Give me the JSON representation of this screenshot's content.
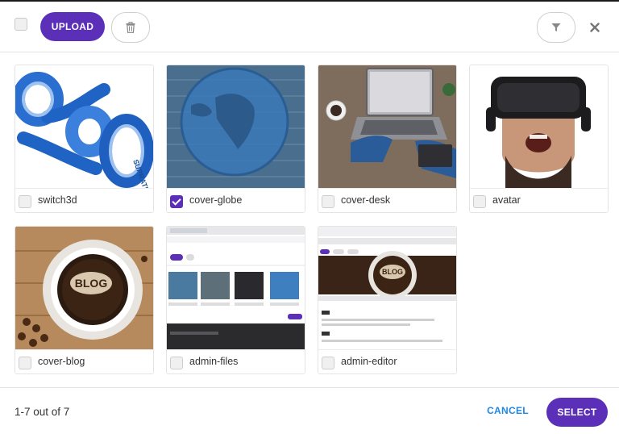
{
  "header": {
    "upload_label": "UPLOAD",
    "delete_icon": "trash-icon",
    "filter_icon": "filter-icon",
    "close_icon": "close-icon"
  },
  "files": [
    {
      "name": "switch3d",
      "checked": false
    },
    {
      "name": "cover-globe",
      "checked": true
    },
    {
      "name": "cover-desk",
      "checked": false
    },
    {
      "name": "avatar",
      "checked": false
    },
    {
      "name": "cover-blog",
      "checked": false
    },
    {
      "name": "admin-files",
      "checked": false
    },
    {
      "name": "admin-editor",
      "checked": false
    }
  ],
  "thumbnails": {
    "switch3d_text": "SUPRATIX",
    "cover_blog_text": "BLOG",
    "admin_editor_text": "BLOG"
  },
  "footer": {
    "count_text": "1-7 out of 7",
    "cancel_label": "CANCEL",
    "select_label": "SELECT"
  },
  "colors": {
    "accent": "#5b2fb8",
    "link": "#1e88e5"
  }
}
